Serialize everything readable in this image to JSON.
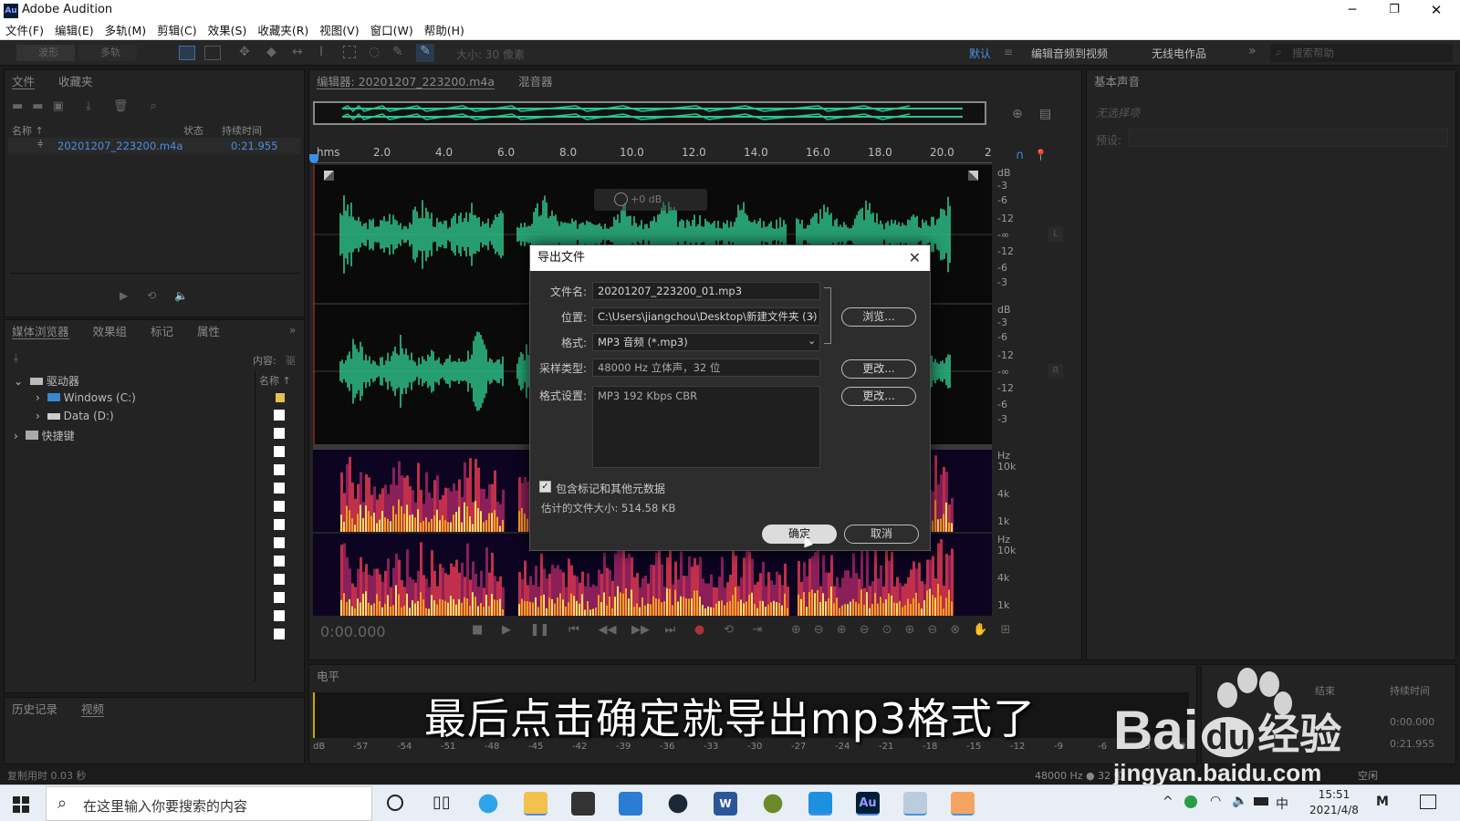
{
  "window": {
    "title": "Adobe Audition",
    "app_icon": "Au"
  },
  "menu": [
    "文件(F)",
    "编辑(E)",
    "多轨(M)",
    "剪辑(C)",
    "效果(S)",
    "收藏夹(R)",
    "视图(V)",
    "窗口(W)",
    "帮助(H)"
  ],
  "toolbar": {
    "waveform": "波形",
    "multitrack": "多轨",
    "size_label": "大小: 30 像素",
    "workspace_default": "默认",
    "workspace_edit_video": "编辑音频到视频",
    "workspace_radio": "无线电作品",
    "search_placeholder": "搜索帮助"
  },
  "files_panel": {
    "tabs": [
      "文件",
      "收藏夹"
    ],
    "col_name": "名称 ↑",
    "col_status": "状态",
    "col_duration": "持续时间",
    "file_name": "20201207_223200.m4a",
    "file_duration": "0:21.955"
  },
  "media_panel": {
    "tabs": [
      "媒体浏览器",
      "效果组",
      "标记",
      "属性"
    ],
    "content_label": "内容:",
    "content_value": "驱",
    "tree_drives": "驱动器",
    "tree_c": "Windows (C:)",
    "tree_d": "Data (D:)",
    "tree_shortcuts": "快捷键",
    "list_col_name": "名称 ↑"
  },
  "history_panel": {
    "tabs": [
      "历史记录",
      "视频"
    ]
  },
  "status_left": "复制用时 0.03 秒",
  "editor": {
    "tab_editor": "编辑器: 20201207_223200.m4a",
    "tab_mixer": "混音器",
    "time_unit": "hms",
    "time_ticks": [
      "2.0",
      "4.0",
      "6.0",
      "8.0",
      "10.0",
      "12.0",
      "14.0",
      "16.0",
      "18.0",
      "20.0",
      "2"
    ],
    "db_scale_top": [
      "dB",
      "-3",
      "-6",
      "-12",
      "-∞",
      "-12",
      "-6",
      "-3"
    ],
    "db_scale_bottom": [
      "dB",
      "-3",
      "-6",
      "-12",
      "-∞",
      "-12",
      "-6",
      "-3"
    ],
    "hz_scale_1": [
      "Hz",
      "10k",
      "4k",
      "1k"
    ],
    "hz_scale_2": [
      "Hz",
      "10k",
      "4k",
      "1k"
    ],
    "channel_l": "L",
    "channel_r": "R",
    "hud_db": "+0 dB",
    "current_time": "0:00.000"
  },
  "essential_sound": {
    "title": "基本声音",
    "no_selection": "无选择项",
    "preset_label": "预设:"
  },
  "levels_panel": {
    "title": "电平",
    "scale": [
      "dB",
      "-57",
      "-54",
      "-51",
      "-48",
      "-45",
      "-42",
      "-39",
      "-36",
      "-33",
      "-30",
      "-27",
      "-24",
      "-21",
      "-18",
      "-15",
      "-12",
      "-9",
      "-6",
      "-3",
      "0"
    ]
  },
  "selection_panel": {
    "col_end": "结束",
    "col_duration": "持续时间",
    "start": "0:00.000",
    "duration": "0:21.955"
  },
  "status_right": "48000 Hz ● 32 位",
  "status_right_free": "空闲",
  "dialog": {
    "title": "导出文件",
    "filename_label": "文件名:",
    "filename_value": "20201207_223200_01.mp3",
    "location_label": "位置:",
    "location_value": "C:\\Users\\jiangchou\\Desktop\\新建文件夹 (3)",
    "browse": "浏览...",
    "format_label": "格式:",
    "format_value": "MP3 音频 (*.mp3)",
    "sample_label": "采样类型:",
    "sample_value": "48000 Hz 立体声，32 位",
    "change1": "更改...",
    "format_settings_label": "格式设置:",
    "format_settings_value": "MP3 192 Kbps CBR",
    "change2": "更改...",
    "include_markers": "包含标记和其他元数据",
    "estimated_size": "估计的文件大小: 514.58 KB",
    "ok": "确定",
    "cancel": "取消"
  },
  "subtitle": "最后点击确定就导出mp3格式了",
  "watermark": {
    "brand": "Bai",
    "brand2": "du",
    "brand_cn": "经验",
    "url": "jingyan.baidu.com"
  },
  "taskbar": {
    "search_placeholder": "在这里输入你要搜索的内容",
    "time": "15:51",
    "date": "2021/4/8",
    "ime": "中"
  }
}
